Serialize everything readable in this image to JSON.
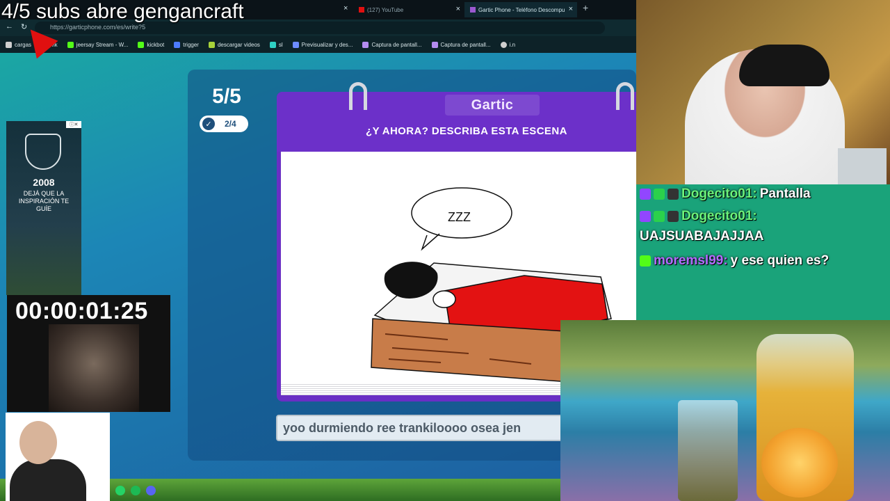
{
  "overlay": {
    "subs_banner": "4/5 subs abre gengancraft",
    "timer": "00:00:01:25"
  },
  "browser": {
    "tabs": [
      {
        "label": "(127) YouTube"
      },
      {
        "label": "Gartic Phone - Teléfono Descompu"
      }
    ],
    "url": "https://garticphone.com/es/write?5",
    "bookmarks": [
      "cargas",
      "mk",
      "jeersay Stream - W...",
      "kickbot",
      "trigger",
      "descargar videos",
      "sl",
      "Previsualizar y des...",
      "Captura de pantall...",
      "Captura de pantall...",
      "i.n"
    ]
  },
  "game": {
    "round": "5/5",
    "progress": "2/4",
    "logo": "Gartic",
    "title": "¿Y AHORA? DESCRIBA ESTA ESCENA",
    "drawing_text": "ZZZ",
    "answer_value": "yoo durmiendo ree trankiloooo osea jen"
  },
  "ad": {
    "year": "2008",
    "tagline": "DEJÁ QUE LA INSPIRACIÓN TE GUÍE"
  },
  "chat": [
    {
      "user": "Dogecito01:",
      "message": "Pantalla"
    },
    {
      "user": "Dogecito01:",
      "message": "UAJSUABAJAJJAA"
    },
    {
      "user": "moremsl99:",
      "message": "y ese quien es?"
    }
  ],
  "colors": {
    "accent_purple": "#6c30c9",
    "page_teal": "#1ba7a3",
    "chat_green": "#1aa37a"
  }
}
